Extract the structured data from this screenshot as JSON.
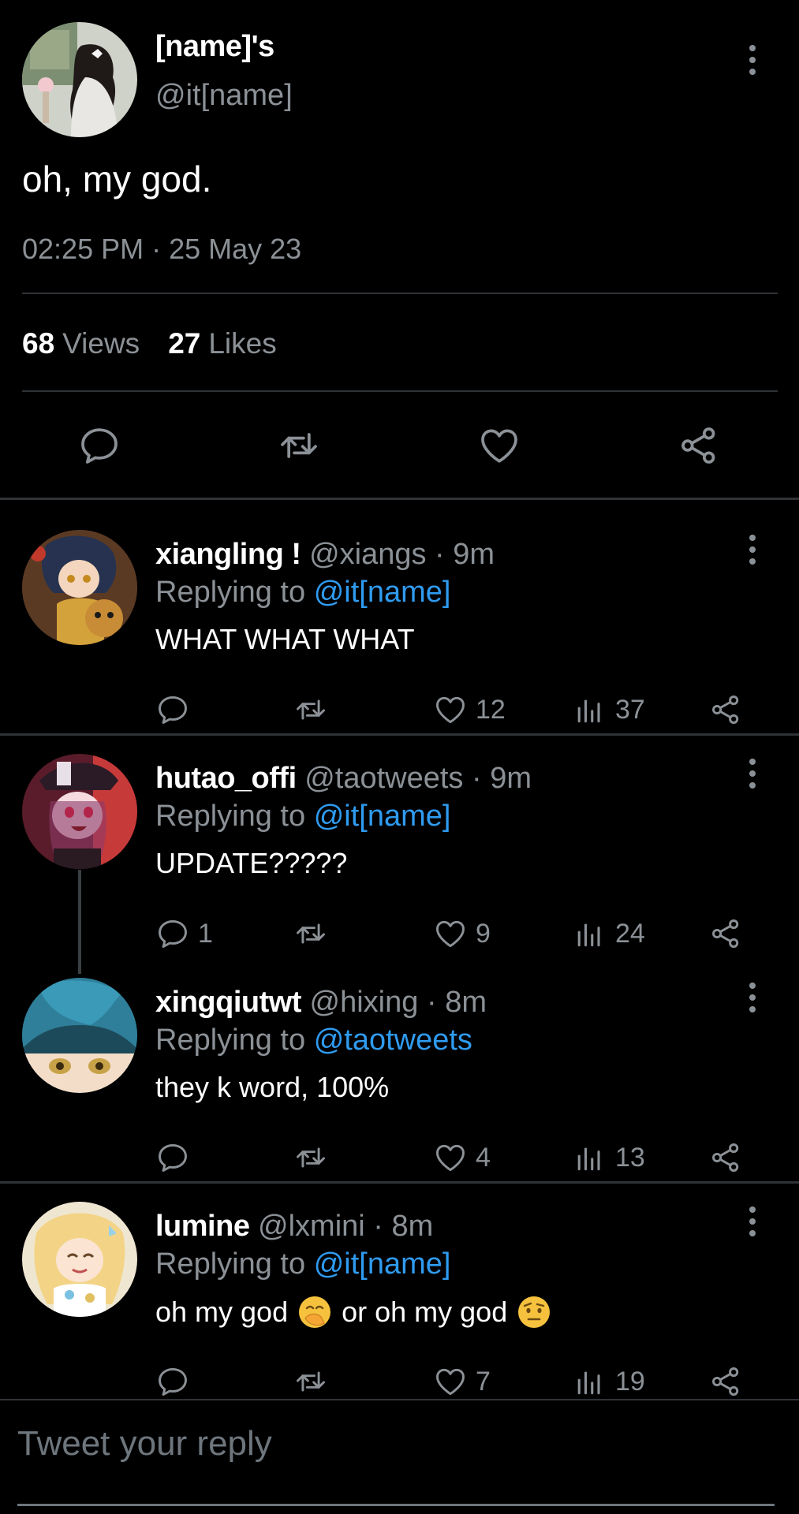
{
  "main_tweet": {
    "display_name": "[name]'s",
    "handle": "@it[name]",
    "text": "oh, my god.",
    "timestamp": "02:25 PM · 25 May 23",
    "views_count": "68",
    "views_label": "Views",
    "likes_count": "27",
    "likes_label": "Likes"
  },
  "replies": [
    {
      "name": "xiangling !",
      "handle": "@xiangs",
      "dot": "·",
      "age": "9m",
      "replying_prefix": "Replying to",
      "replying_to": "@it[name]",
      "text": "WHAT WHAT WHAT",
      "reply_count": "",
      "like_count": "12",
      "view_count": "37"
    },
    {
      "name": "hutao_offi",
      "handle": "@taotweets",
      "dot": "·",
      "age": "9m",
      "replying_prefix": "Replying to",
      "replying_to": "@it[name]",
      "text": "UPDATE?????",
      "reply_count": "1",
      "like_count": "9",
      "view_count": "24"
    },
    {
      "name": "xingqiutwt",
      "handle": "@hixing",
      "dot": "·",
      "age": "8m",
      "replying_prefix": "Replying to",
      "replying_to": "@taotweets",
      "text": "they k word, 100%",
      "reply_count": "",
      "like_count": "4",
      "view_count": "13"
    },
    {
      "name": "lumine",
      "handle": "@lxmini",
      "dot": "·",
      "age": "8m",
      "replying_prefix": "Replying to",
      "replying_to": "@it[name]",
      "text_part1": "oh my god",
      "text_part2": "or oh my god",
      "reply_count": "",
      "like_count": "7",
      "view_count": "19"
    }
  ],
  "reply_box": {
    "placeholder": "Tweet your reply"
  },
  "icons": {
    "reply": "comment-bubble-icon",
    "retweet": "retweet-icon",
    "like": "heart-icon",
    "views": "bar-chart-icon",
    "share": "share-icon",
    "more": "more-vertical-icon"
  },
  "colors": {
    "background": "#000000",
    "muted": "#8b9196",
    "link": "#2f9bf0",
    "divider": "#2f3336"
  }
}
